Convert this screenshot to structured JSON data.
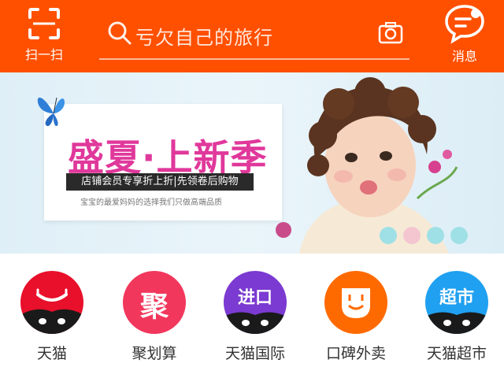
{
  "header": {
    "scan_label": "扫一扫",
    "search_placeholder": "亏欠自己的旅行",
    "message_label": "消息",
    "accent_color": "#ff5000"
  },
  "banner": {
    "title_part1": "盛夏",
    "title_dot": "·",
    "title_part2": "上新季",
    "subtitle": "店铺会员专享折上折|先领卷后购物",
    "small_text": "宝宝的最爱妈妈的选择我们只做高端品质"
  },
  "nav_icons": [
    {
      "label": "天猫",
      "icon": "tmall-icon",
      "color": "#e8102a"
    },
    {
      "label": "聚划算",
      "icon": "juhuasuan-icon",
      "color": "#f2375c",
      "glyph": "聚"
    },
    {
      "label": "天猫国际",
      "icon": "tmall-global-icon",
      "color": "#7b3ad1",
      "glyph": "进口"
    },
    {
      "label": "口碑外卖",
      "icon": "koubei-icon",
      "color": "#ff6a00"
    },
    {
      "label": "天猫超市",
      "icon": "tmall-supermarket-icon",
      "color": "#20a0f0",
      "glyph": "超市"
    }
  ]
}
